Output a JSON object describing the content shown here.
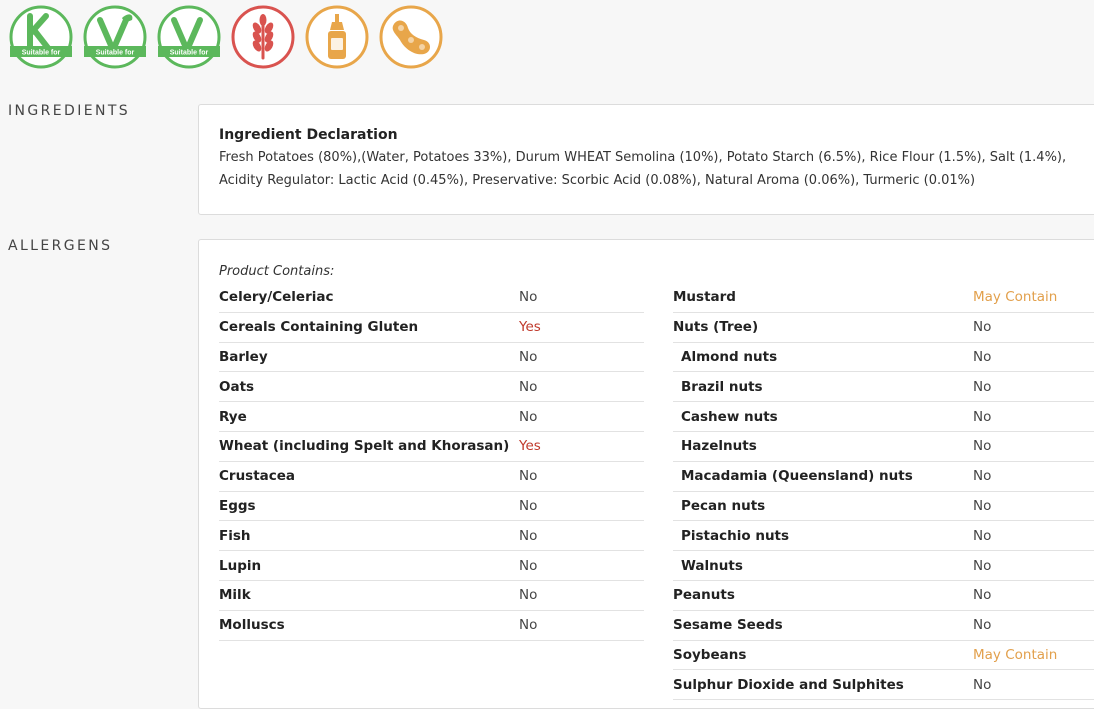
{
  "badges": [
    {
      "icon": "kosher-icon",
      "letter": "K",
      "caption": "Suitable for",
      "color": "#5cb85c"
    },
    {
      "icon": "vegetarian-icon",
      "letter": "V",
      "caption": "Suitable for",
      "color": "#5cb85c"
    },
    {
      "icon": "vegan-icon",
      "letter": "V",
      "caption": "Suitable for",
      "color": "#5cb85c"
    },
    {
      "icon": "gluten-wheat-icon",
      "color": "#d9534f"
    },
    {
      "icon": "mustard-icon",
      "color": "#e8a64a"
    },
    {
      "icon": "soybean-icon",
      "color": "#e8a64a"
    }
  ],
  "sections": {
    "ingredients": "INGREDIENTS",
    "allergens": "ALLERGENS"
  },
  "ingredients": {
    "heading": "Ingredient Declaration",
    "text": "Fresh Potatoes (80%),(Water, Potatoes 33%), Durum WHEAT Semolina (10%), Potato Starch (6.5%), Rice Flour (1.5%), Salt (1.4%), Acidity Regulator: Lactic Acid (0.45%), Preservative: Scorbic Acid (0.08%), Natural Aroma (0.06%), Turmeric (0.01%)"
  },
  "allergens": {
    "intro": "Product Contains:",
    "left": [
      {
        "name": "Celery/Celeriac",
        "value": "No",
        "status": "no"
      },
      {
        "name": "Cereals Containing Gluten",
        "value": "Yes",
        "status": "yes"
      },
      {
        "name": "Barley",
        "value": "No",
        "status": "no"
      },
      {
        "name": "Oats",
        "value": "No",
        "status": "no"
      },
      {
        "name": "Rye",
        "value": "No",
        "status": "no"
      },
      {
        "name": "Wheat (including Spelt and Khorasan)",
        "value": "Yes",
        "status": "yes"
      },
      {
        "name": "Crustacea",
        "value": "No",
        "status": "no"
      },
      {
        "name": "Eggs",
        "value": "No",
        "status": "no"
      },
      {
        "name": "Fish",
        "value": "No",
        "status": "no"
      },
      {
        "name": "Lupin",
        "value": "No",
        "status": "no"
      },
      {
        "name": "Milk",
        "value": "No",
        "status": "no"
      },
      {
        "name": "Molluscs",
        "value": "No",
        "status": "no"
      }
    ],
    "right": [
      {
        "name": "Mustard",
        "value": "May Contain",
        "status": "may"
      },
      {
        "name": "Nuts (Tree)",
        "value": "No",
        "status": "no"
      },
      {
        "name": "Almond nuts",
        "value": "No",
        "status": "no",
        "indent": true
      },
      {
        "name": "Brazil nuts",
        "value": "No",
        "status": "no",
        "indent": true
      },
      {
        "name": "Cashew nuts",
        "value": "No",
        "status": "no",
        "indent": true
      },
      {
        "name": "Hazelnuts",
        "value": "No",
        "status": "no",
        "indent": true
      },
      {
        "name": "Macadamia (Queensland) nuts",
        "value": "No",
        "status": "no",
        "indent": true
      },
      {
        "name": "Pecan nuts",
        "value": "No",
        "status": "no",
        "indent": true
      },
      {
        "name": "Pistachio nuts",
        "value": "No",
        "status": "no",
        "indent": true
      },
      {
        "name": "Walnuts",
        "value": "No",
        "status": "no",
        "indent": true
      },
      {
        "name": "Peanuts",
        "value": "No",
        "status": "no"
      },
      {
        "name": "Sesame Seeds",
        "value": "No",
        "status": "no"
      },
      {
        "name": "Soybeans",
        "value": "May Contain",
        "status": "may"
      },
      {
        "name": "Sulphur Dioxide and Sulphites",
        "value": "No",
        "status": "no"
      }
    ]
  }
}
